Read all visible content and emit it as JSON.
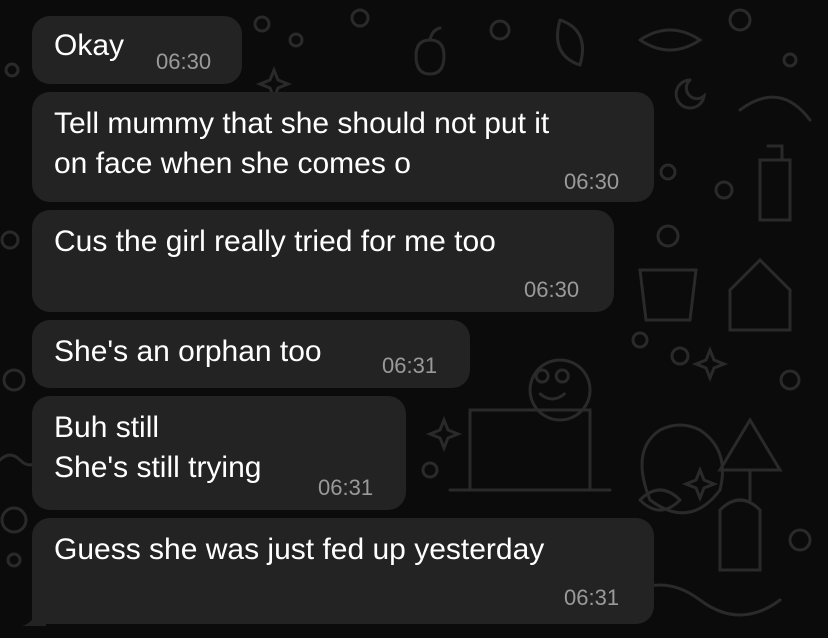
{
  "messages": [
    {
      "lines": [
        "Okay"
      ],
      "time": "06:30"
    },
    {
      "lines": [
        "Tell mummy that she should not put it",
        "on face when she comes o"
      ],
      "time": "06:30"
    },
    {
      "lines": [
        "Cus the girl really tried for me too"
      ],
      "time": "06:30"
    },
    {
      "lines": [
        "She's an orphan too"
      ],
      "time": "06:31"
    },
    {
      "lines": [
        "Buh still",
        "She's still trying"
      ],
      "time": "06:31"
    },
    {
      "lines": [
        "Guess she was just fed up yesterday"
      ],
      "time": "06:31"
    }
  ],
  "colors": {
    "background": "#0b0b0b",
    "bubble": "#232323",
    "text": "#ffffff",
    "timestamp": "#9a9a9a",
    "doodle": "#2a2a2a"
  }
}
